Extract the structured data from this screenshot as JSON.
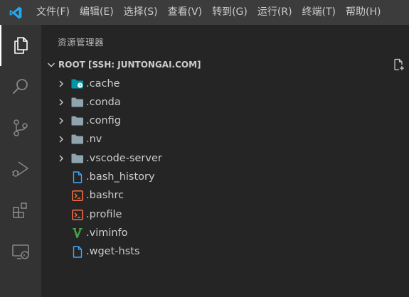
{
  "menu": [
    "文件(F)",
    "编辑(E)",
    "选择(S)",
    "查看(V)",
    "转到(G)",
    "运行(R)",
    "终端(T)",
    "帮助(H)"
  ],
  "activity_bar": [
    "explorer-icon",
    "search-icon",
    "source-control-icon",
    "run-debug-icon",
    "extensions-icon",
    "remote-explorer-icon"
  ],
  "sidebar": {
    "title": "资源管理器",
    "section_title": "ROOT [SSH: JUNTONGAI.COM]",
    "items": [
      {
        "label": ".cache",
        "kind": "folder",
        "icon": "folder-cache-icon"
      },
      {
        "label": ".conda",
        "kind": "folder",
        "icon": "folder-icon"
      },
      {
        "label": ".config",
        "kind": "folder",
        "icon": "folder-icon"
      },
      {
        "label": ".nv",
        "kind": "folder",
        "icon": "folder-icon"
      },
      {
        "label": ".vscode-server",
        "kind": "folder",
        "icon": "folder-icon"
      },
      {
        "label": ".bash_history",
        "kind": "file",
        "icon": "file-icon"
      },
      {
        "label": ".bashrc",
        "kind": "file",
        "icon": "terminal-file-icon"
      },
      {
        "label": ".profile",
        "kind": "file",
        "icon": "terminal-file-icon"
      },
      {
        "label": ".viminfo",
        "kind": "file",
        "icon": "vim-file-icon"
      },
      {
        "label": ".wget-hsts",
        "kind": "file",
        "icon": "file-icon"
      }
    ]
  },
  "colors": {
    "titlebar": "#3c3c3c",
    "activity_bar": "#333333",
    "sidebar": "#252526",
    "folder": "#90a4ae",
    "file_blue": "#42a5f5",
    "terminal_file": "#ff7043",
    "vim_green": "#43a047",
    "logo_blue": "#23a9f2"
  }
}
